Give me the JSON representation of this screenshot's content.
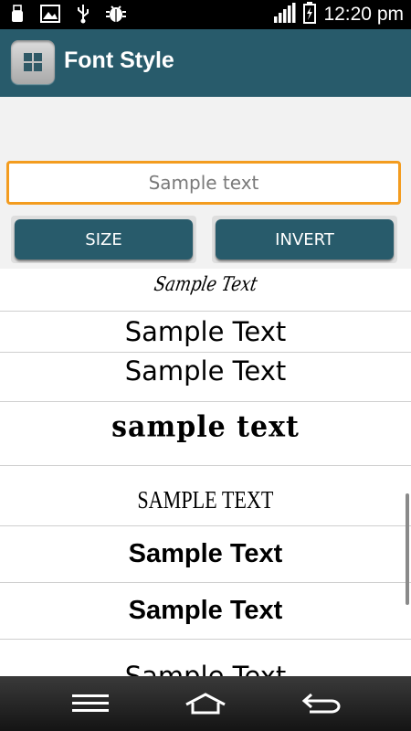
{
  "status_bar": {
    "time": "12:20 pm",
    "left_icons": [
      "usb-icon",
      "image-icon",
      "usb-debug-icon",
      "android-debug-icon"
    ],
    "right_icons": [
      "signal-icon",
      "battery-charging-icon"
    ]
  },
  "action_bar": {
    "title": "Font Style",
    "app_icon": "grid-app-icon",
    "background": "#285b6b"
  },
  "input": {
    "placeholder": "Sample text",
    "value": "",
    "border_color": "#f39c1f"
  },
  "buttons": {
    "size_label": "SIZE",
    "invert_label": "INVERT"
  },
  "font_list": [
    {
      "text": "Sample Text"
    },
    {
      "text": "Sample Text"
    },
    {
      "text": "Sample Text"
    },
    {
      "text": "sample text"
    },
    {
      "text": "SAMPLE TEXT"
    },
    {
      "text": "Sample Text"
    },
    {
      "text": "Sample Text"
    },
    {
      "text": "Sample Text"
    }
  ],
  "nav_bar": {
    "icons": [
      "menu-icon",
      "home-icon",
      "back-icon"
    ]
  }
}
